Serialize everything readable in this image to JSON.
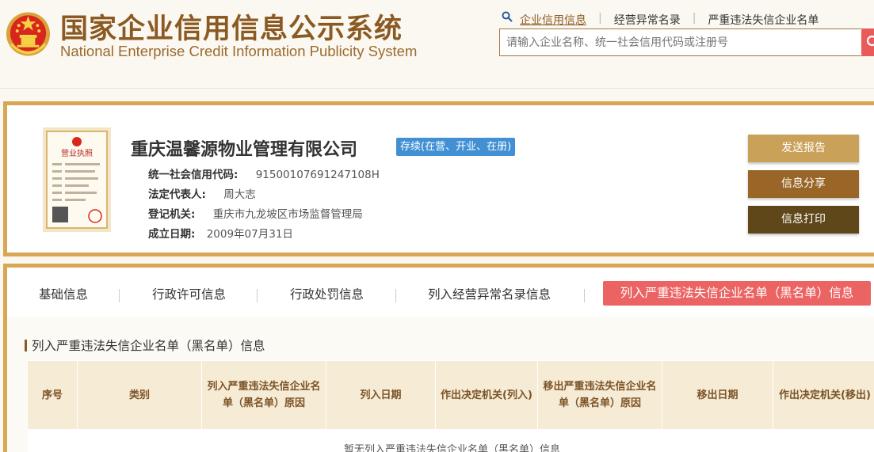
{
  "header": {
    "title_cn": "国家企业信用信息公示系统",
    "title_en": "National Enterprise Credit Information Publicity System",
    "search_tabs": [
      "企业信用信息",
      "经营异常名录",
      "严重违法失信企业名单"
    ],
    "search_placeholder": "请输入企业名称、统一社会信用代码或注册号",
    "emblem_icon": "national-emblem-icon",
    "search_icon": "magnifier-icon"
  },
  "company": {
    "name": "重庆温馨源物业管理有限公司",
    "status": "存续(在营、开业、在册)",
    "credit_code_label": "统一社会信用代码:",
    "credit_code": "91500107691247108H",
    "legal_rep_label": "法定代表人:",
    "legal_rep": "周大志",
    "registry_label": "登记机关:",
    "registry": "重庆市九龙坡区市场监督管理局",
    "founded_label": "成立日期:",
    "founded": "2009年07月31日",
    "license_text": "营业执照"
  },
  "actions": {
    "report": "发送报告",
    "share": "信息分享",
    "print": "信息打印"
  },
  "tabs": [
    "基础信息",
    "行政许可信息",
    "行政处罚信息",
    "列入经营异常名录信息",
    "列入严重违法失信企业名单（黑名单）信息"
  ],
  "section": {
    "title": "列入严重违法失信企业名单（黑名单）信息",
    "columns": [
      "序号",
      "类别",
      "列入严重违法失信企业名单（黑名单）原因",
      "列入日期",
      "作出决定机关(列入)",
      "移出严重违法失信企业名单（黑名单）原因",
      "移出日期",
      "作出决定机关(移出)"
    ],
    "empty_text": "暂无列入严重违法失信企业名单（黑名单）信息"
  },
  "colors": {
    "brand": "#8b5a22",
    "card_border": "#d8a655",
    "status_badge": "#4190d3",
    "active_tab": "#ec6363",
    "btn_report": "#c9a158",
    "btn_share": "#996627",
    "btn_print": "#5f4719"
  }
}
